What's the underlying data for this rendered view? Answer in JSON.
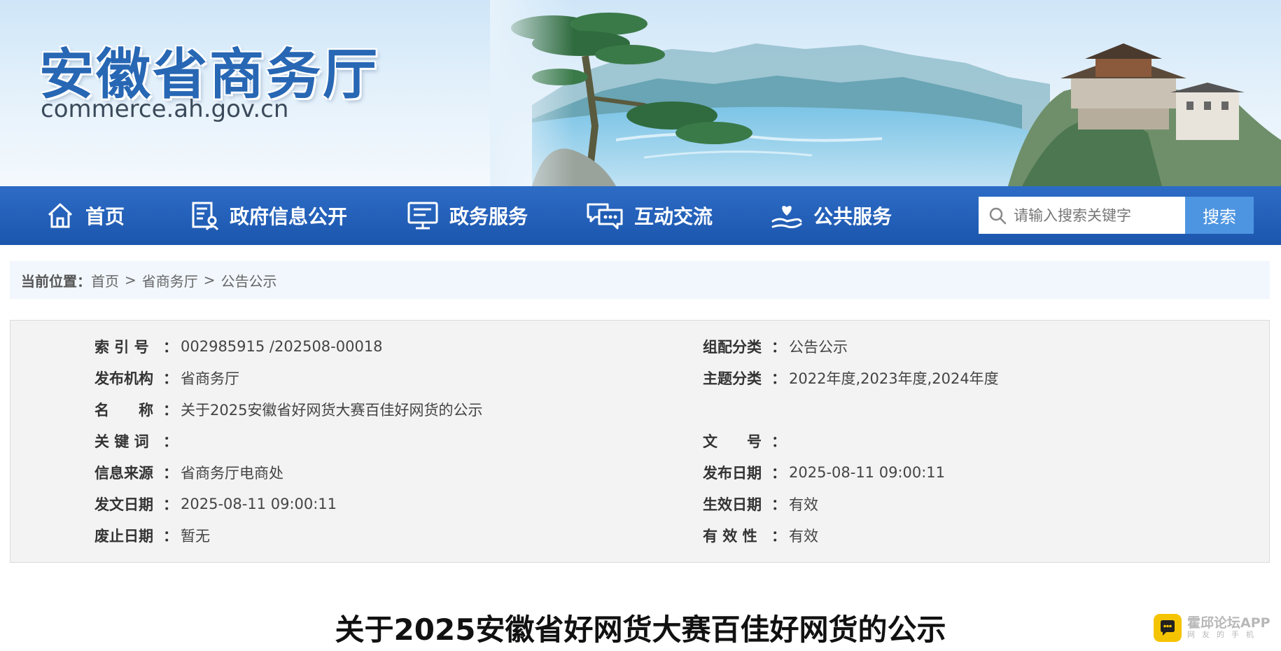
{
  "header": {
    "site_name": "安徽省商务厅",
    "site_domain": "commerce.ah.gov.cn"
  },
  "nav": {
    "items": [
      {
        "label": "首页",
        "icon": "home-icon"
      },
      {
        "label": "政府信息公开",
        "icon": "document-user-icon"
      },
      {
        "label": "政务服务",
        "icon": "monitor-icon"
      },
      {
        "label": "互动交流",
        "icon": "chat-bubbles-icon"
      },
      {
        "label": "公共服务",
        "icon": "hand-heart-icon"
      }
    ],
    "search": {
      "placeholder": "请输入搜索关键字",
      "button_label": "搜索"
    }
  },
  "breadcrumb": {
    "label": "当前位置：",
    "items": [
      "首页",
      "省商务厅",
      "公告公示"
    ],
    "separator": ">"
  },
  "info": {
    "left": [
      {
        "label": "索 引 号",
        "value": "002985915 /202508-00018"
      },
      {
        "label": "发布机构",
        "value": "省商务厅"
      },
      {
        "label": "名　　称",
        "value": "关于2025安徽省好网货大赛百佳好网货的公示"
      },
      {
        "label": "关 键 词",
        "value": ""
      },
      {
        "label": "信息来源",
        "value": "省商务厅电商处"
      },
      {
        "label": "发文日期",
        "value": "2025-08-11 09:00:11"
      },
      {
        "label": "废止日期",
        "value": "暂无"
      }
    ],
    "right": [
      {
        "label": "组配分类",
        "value": "公告公示"
      },
      {
        "label": "主题分类",
        "value": "2022年度,2023年度,2024年度"
      },
      {
        "label": "文　　号",
        "value": ""
      },
      {
        "label": "发布日期",
        "value": "2025-08-11 09:00:11"
      },
      {
        "label": "生效日期",
        "value": "有效"
      },
      {
        "label": "有 效 性",
        "value": "有效"
      }
    ],
    "colon": "："
  },
  "article": {
    "title": "关于2025安徽省好网货大赛百佳好网货的公示"
  },
  "watermark": {
    "main": "霍邱论坛APP",
    "sub": "网友的手机"
  },
  "colors": {
    "nav_bg": "#1f5cb3",
    "search_button": "#4e95e1",
    "site_name": "#2767b4",
    "breadcrumb_bg": "#f1f7fd",
    "info_bg": "#f3f3f3"
  }
}
